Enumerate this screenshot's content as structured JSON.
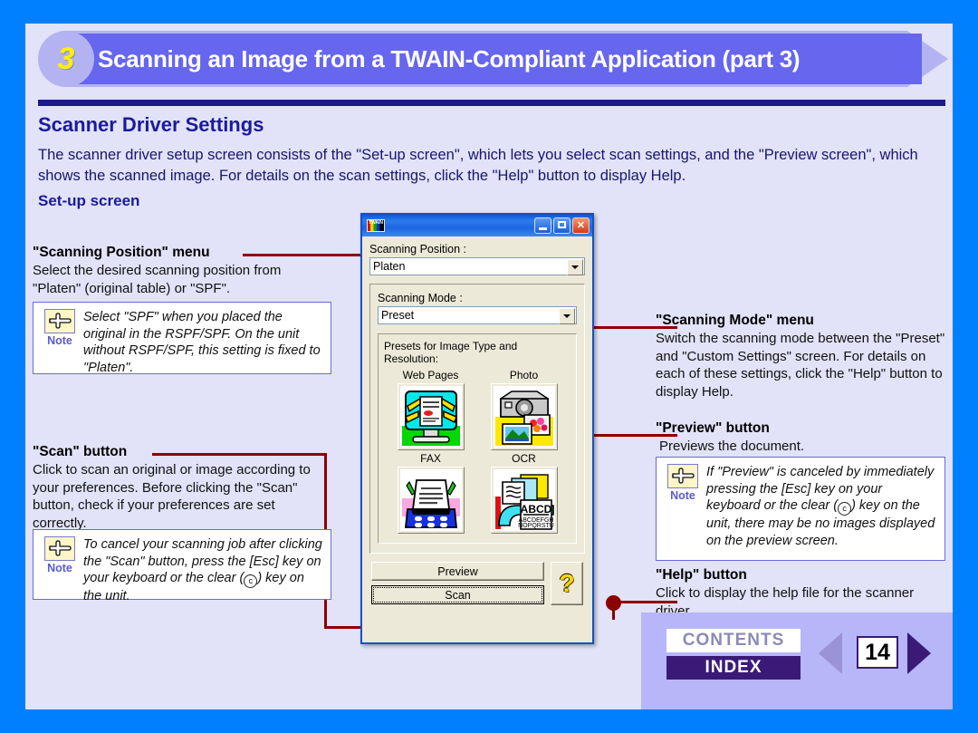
{
  "header": {
    "step_number": "3",
    "title": "Scanning an Image from a TWAIN-Compliant Application (part 3)"
  },
  "section": {
    "heading": "Scanner Driver Settings",
    "intro": "The scanner driver setup screen consists of the \"Set-up screen\", which lets you select scan settings, and the \"Preview screen\", which shows the scanned image. For details on the scan settings, click the \"Help\" button to display Help.",
    "subheading": "Set-up screen"
  },
  "callouts": {
    "scanning_position": {
      "title": "\"Scanning Position\" menu",
      "body": "Select the desired scanning position from \"Platen\" (original table) or \"SPF\".",
      "note_label": "Note",
      "note_text": "Select \"SPF\" when you placed the original in the RSPF/SPF. On the unit without RSPF/SPF, this setting  is fixed to \"Platen\"."
    },
    "scan_button": {
      "title": "\"Scan\" button",
      "body": "Click to scan an original or image according to your preferences. Before clicking the \"Scan\" button, check if your preferences are set correctly.",
      "note_label": "Note",
      "note_text_1": "To cancel your scanning job after clicking the \"Scan\" button, press the [Esc] key on your keyboard or the clear (",
      "note_text_2": ") key on the unit."
    },
    "scanning_mode": {
      "title": "\"Scanning Mode\" menu",
      "body": "Switch the scanning mode between the \"Preset\" and \"Custom Settings\" screen. For details on each of these settings, click the \"Help\" button to display Help."
    },
    "preview_button": {
      "title": "\"Preview\" button",
      "body": "Previews the document.",
      "note_label": "Note",
      "note_text_1": "If \"Preview\" is canceled by immediately pressing the [Esc] key on your keyboard or the clear (",
      "note_text_2": ") key on the unit, there may be no images displayed on the preview screen."
    },
    "help_button": {
      "title": "\"Help\" button",
      "body": "Click to display the help file for the scanner driver."
    }
  },
  "dialog": {
    "icon_name": "twain-icon",
    "minimize_label": "minimize-icon",
    "maximize_label": "maximize-icon",
    "close_label": "✕",
    "scanning_position_label": "Scanning Position :",
    "scanning_position_value": "Platen",
    "scanning_mode_label": "Scanning Mode :",
    "scanning_mode_value": "Preset",
    "presets_caption": "Presets for Image Type and Resolution:",
    "presets": [
      {
        "label": "Web Pages",
        "icon": "monitor-webpage-icon"
      },
      {
        "label": "Photo",
        "icon": "camera-photo-icon"
      },
      {
        "label": "FAX",
        "icon": "fax-machine-icon"
      },
      {
        "label": "OCR",
        "icon": "ocr-document-icon"
      }
    ],
    "preview_button": "Preview",
    "scan_button": "Scan",
    "help_button": "?",
    "ocr_sample_big": "ABCD",
    "ocr_sample_1": "ABCDEFGH",
    "ocr_sample_2": "NOPQRSTU"
  },
  "footer": {
    "contents_label": "CONTENTS",
    "index_label": "INDEX",
    "page_number": "14",
    "prev_icon": "arrow-left-icon",
    "next_icon": "arrow-right-icon"
  },
  "colors": {
    "outer_frame": "#0080FF",
    "page_background": "#E2E2F8",
    "banner": "#6666EE",
    "banner_arrow": "#B3B3F2",
    "heading": "#1A1A9E",
    "rule": "#1A1A8C",
    "callout_line": "#8B0000",
    "note_border": "#6A6AD8",
    "note_icon_fill": "#FFF6C8",
    "footer_band": "#B6B6F8",
    "index_button": "#3B1A77",
    "dialog_face": "#ECE9D8",
    "dialog_border": "#1152C6"
  }
}
